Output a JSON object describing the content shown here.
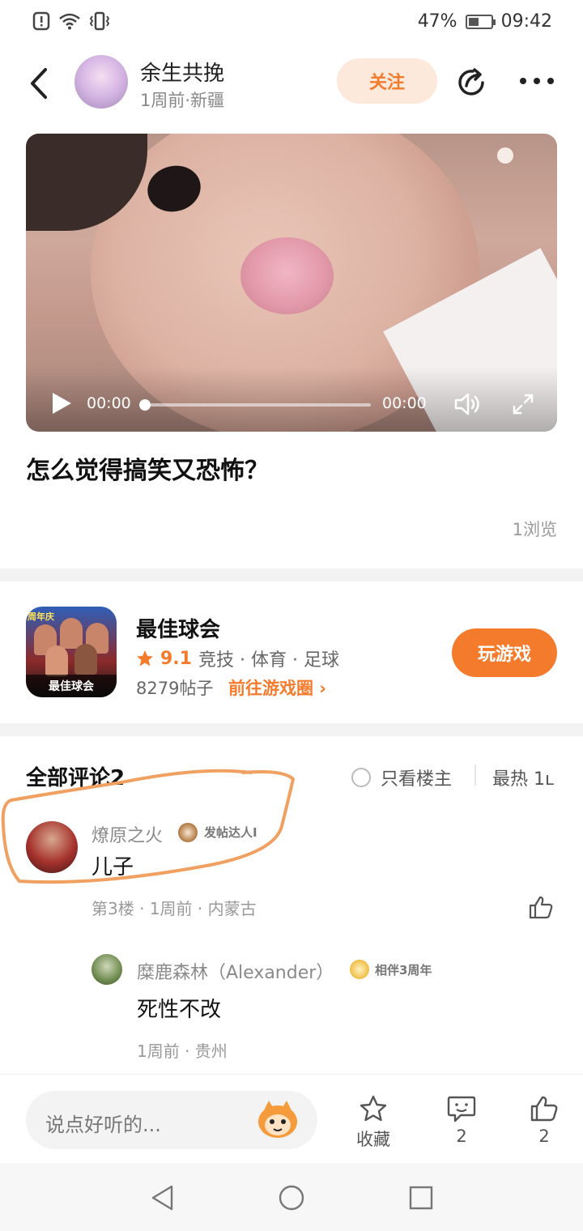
{
  "status_bar": {
    "battery": "47%",
    "battery_level": 0.47,
    "time": "09:42"
  },
  "header": {
    "username": "余生共挽",
    "meta": "1周前·新疆",
    "follow_label": "关注"
  },
  "video": {
    "current_time": "00:00",
    "duration": "00:00",
    "progress": 0
  },
  "post": {
    "title": "怎么觉得搞笑又恐怖？",
    "views": "1浏览"
  },
  "game": {
    "name": "最佳球会",
    "rating": "9.1",
    "tags": "竞技 · 体育 · 足球",
    "posts": "8279帖子",
    "link": "前往游戏圈 ›",
    "play_label": "玩游戏",
    "icon_text": "最佳球会",
    "icon_tag": "周年庆"
  },
  "comments": {
    "header": "全部评论2",
    "only_owner": "只看楼主",
    "sort": "最热 1ʟ",
    "items": [
      {
        "name": "燎原之火",
        "badge": "发帖达人I",
        "text": "儿子",
        "meta": "第3楼 · 1周前 · 内蒙古",
        "reply": {
          "name": "糜鹿森林（Alexander）",
          "badge": "相伴3周年",
          "text": "死性不改",
          "meta": "1周前 · 贵州"
        }
      }
    ]
  },
  "bottom_bar": {
    "placeholder": "说点好听的...",
    "favorite_label": "收藏",
    "comment_count": "2",
    "like_count": "2"
  },
  "colors": {
    "accent": "#f57b2c",
    "follow_bg": "#fde8dc",
    "highlight_mark": "#f0a060"
  }
}
